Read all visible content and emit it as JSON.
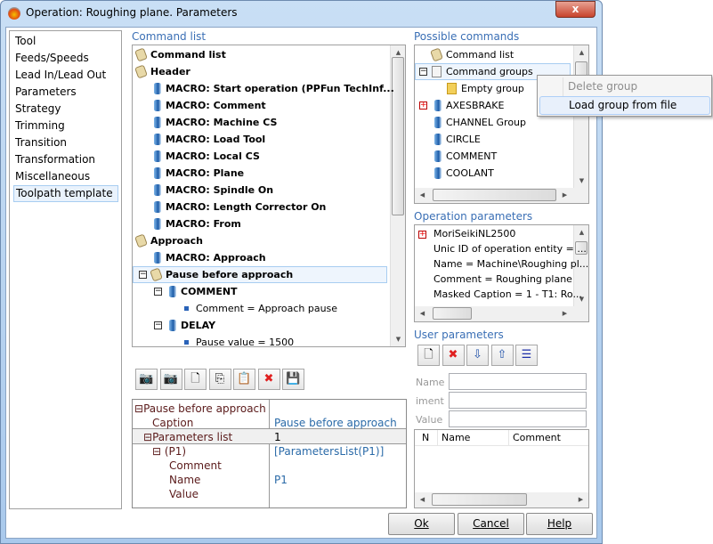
{
  "window": {
    "title": "Operation: Roughing plane. Parameters",
    "close_label": "x"
  },
  "nav": {
    "items": [
      "Tool",
      "Feeds/Speeds",
      "Lead In/Lead Out",
      "Parameters",
      "Strategy",
      "Trimming",
      "Transition",
      "Transformation",
      "Miscellaneous",
      "Toolpath template"
    ],
    "selected": "Toolpath template"
  },
  "command_list": {
    "label": "Command list",
    "rows": [
      {
        "text": "Command list",
        "level": 0,
        "icon": "tag",
        "bold": true,
        "exp": null
      },
      {
        "text": "Header",
        "level": 0,
        "icon": "tag",
        "bold": true,
        "exp": "minus"
      },
      {
        "text": "MACRO: Start operation (PPFun TechInf...",
        "level": 1,
        "icon": "cyl",
        "bold": true
      },
      {
        "text": "MACRO: Comment",
        "level": 1,
        "icon": "cyl",
        "bold": true
      },
      {
        "text": "MACRO: Machine CS",
        "level": 1,
        "icon": "cyl",
        "bold": true
      },
      {
        "text": "MACRO: Load Tool",
        "level": 1,
        "icon": "cyl",
        "bold": true
      },
      {
        "text": "MACRO: Local CS",
        "level": 1,
        "icon": "cyl",
        "bold": true
      },
      {
        "text": "MACRO: Plane",
        "level": 1,
        "icon": "cyl",
        "bold": true
      },
      {
        "text": "MACRO: Spindle On",
        "level": 1,
        "icon": "cyl",
        "bold": true
      },
      {
        "text": "MACRO: Length Corrector On",
        "level": 1,
        "icon": "cyl",
        "bold": true
      },
      {
        "text": "MACRO: From",
        "level": 1,
        "icon": "cyl",
        "bold": true
      },
      {
        "text": "Approach",
        "level": 0,
        "icon": "tag",
        "bold": true,
        "exp": "minus"
      },
      {
        "text": "MACRO: Approach",
        "level": 1,
        "icon": "cyl",
        "bold": true
      },
      {
        "text": "Pause before approach",
        "level": 1,
        "icon": "tag",
        "bold": true,
        "exp": "minus",
        "selected": true
      },
      {
        "text": "COMMENT",
        "level": 2,
        "icon": "cyl",
        "bold": true,
        "exp": "minus"
      },
      {
        "text": "Comment = Approach pause",
        "level": 3,
        "icon": "bul",
        "bold": false
      },
      {
        "text": "DELAY",
        "level": 2,
        "icon": "cyl",
        "bold": true,
        "exp": "minus"
      },
      {
        "text": "Pause value = 1500",
        "level": 3,
        "icon": "bul",
        "bold": false
      }
    ]
  },
  "toolbar": {
    "buttons": [
      {
        "name": "add-command-button",
        "icon": "camera-add-icon",
        "glyph": "📷"
      },
      {
        "name": "add-group-button",
        "icon": "camera-group-icon",
        "glyph": "📷"
      },
      {
        "name": "new-button",
        "icon": "new-document-icon",
        "glyph": "🗋"
      },
      {
        "name": "copy-button",
        "icon": "copy-icon",
        "glyph": "⎘"
      },
      {
        "name": "paste-button",
        "icon": "paste-icon",
        "glyph": "📋"
      },
      {
        "name": "delete-button",
        "icon": "delete-icon",
        "glyph": "✖",
        "color": "#e02020"
      },
      {
        "name": "save-button",
        "icon": "save-icon",
        "glyph": "💾",
        "color": "#1d4fa8"
      }
    ]
  },
  "property_grid": {
    "root": "Pause before approach",
    "caption_key": "Caption",
    "caption_value": "Pause before approach",
    "params_key": "Parameters list",
    "params_value": "1",
    "p1_key": "(P1)",
    "p1_value": "[ParametersList(P1)]",
    "comment_key": "Comment",
    "comment_value": "",
    "name_key": "Name",
    "name_value": "P1",
    "value_key": "Value",
    "value_value": ""
  },
  "possible_commands": {
    "label": "Possible commands",
    "rows": [
      {
        "text": "Command list",
        "level": 0,
        "icon": "tag"
      },
      {
        "text": "Command groups",
        "level": 0,
        "icon": "doc",
        "exp": "minus",
        "selected": true
      },
      {
        "text": "Empty group",
        "level": 1,
        "icon": "folder"
      },
      {
        "text": "AXESBRAKE",
        "level": 0,
        "icon": "cyl",
        "exp": "plus"
      },
      {
        "text": "CHANNEL Group",
        "level": 0,
        "icon": "cyl"
      },
      {
        "text": "CIRCLE",
        "level": 0,
        "icon": "cyl"
      },
      {
        "text": "COMMENT",
        "level": 0,
        "icon": "cyl"
      },
      {
        "text": "COOLANT",
        "level": 0,
        "icon": "cyl"
      }
    ]
  },
  "context_menu": {
    "items": [
      {
        "label": "Delete group",
        "disabled": true
      },
      {
        "label": "Load group from file",
        "highlighted": true
      }
    ]
  },
  "operation_parameters": {
    "label": "Operation parameters",
    "rows": [
      "MoriSeikiNL2500",
      "Unic ID of operation entity = ...",
      "Name = Machine\\Roughing pl...",
      "Comment = Roughing plane",
      "Masked Caption = 1 - T1: Ro..."
    ]
  },
  "user_parameters": {
    "label": "User parameters",
    "buttons": [
      {
        "name": "new-param-button",
        "icon": "new-document-icon",
        "glyph": "🗋"
      },
      {
        "name": "delete-param-button",
        "icon": "delete-icon",
        "glyph": "✖",
        "color": "#e02020"
      },
      {
        "name": "move-down-button",
        "icon": "arrow-down-icon",
        "glyph": "⇩",
        "color": "#1d4fa8"
      },
      {
        "name": "move-up-button",
        "icon": "arrow-up-icon",
        "glyph": "⇧",
        "color": "#1d4fa8"
      },
      {
        "name": "list-button",
        "icon": "list-icon",
        "glyph": "☰",
        "color": "#1d2fa8"
      }
    ],
    "name_label": "Name",
    "comment_label": "iment",
    "value_label": "Value",
    "name_value": "",
    "comment_value": "",
    "value_value": "",
    "columns": [
      "N",
      "Name",
      "Comment"
    ]
  },
  "buttons": {
    "ok": "Ok",
    "cancel": "Cancel",
    "help": "Help"
  },
  "colors": {
    "accent": "#3a6fb5",
    "selection": "#e9f2fc"
  }
}
